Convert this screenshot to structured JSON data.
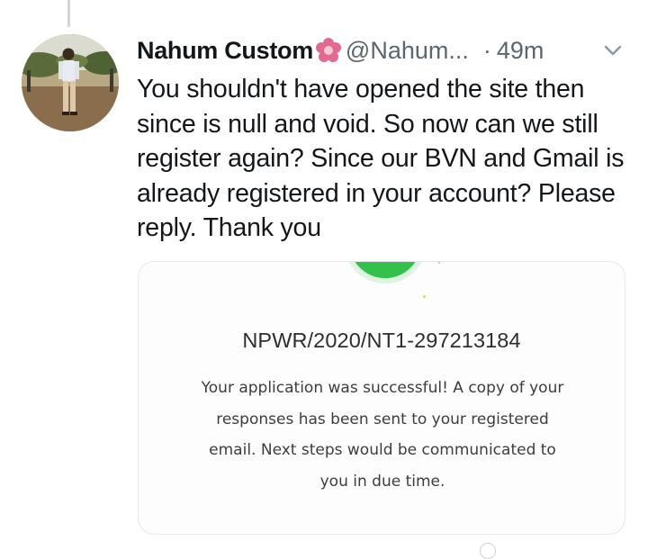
{
  "tweet": {
    "author_name": "Nahum Custom",
    "author_handle": "@Nahum...",
    "separator": "·",
    "time_ago": "49m",
    "text": "You shouldn't have opened the site then since is null and void. So now can we still register again? Since our BVN and Gmail is already registered in your account? Please reply. Thank you"
  },
  "card": {
    "reference_number": "NPWR/2020/NT1-297213184",
    "message": "Your application was successful! A copy of your responses has been sent to your registered email. Next steps would be communicated to you in due time."
  },
  "icons": {
    "name_decoration": "flower-icon",
    "menu": "chevron-down-icon",
    "status": "check-circle-icon"
  },
  "colors": {
    "accent_pink": "#d9577f",
    "success_green": "#33c14b",
    "muted_text": "#5b6670"
  }
}
